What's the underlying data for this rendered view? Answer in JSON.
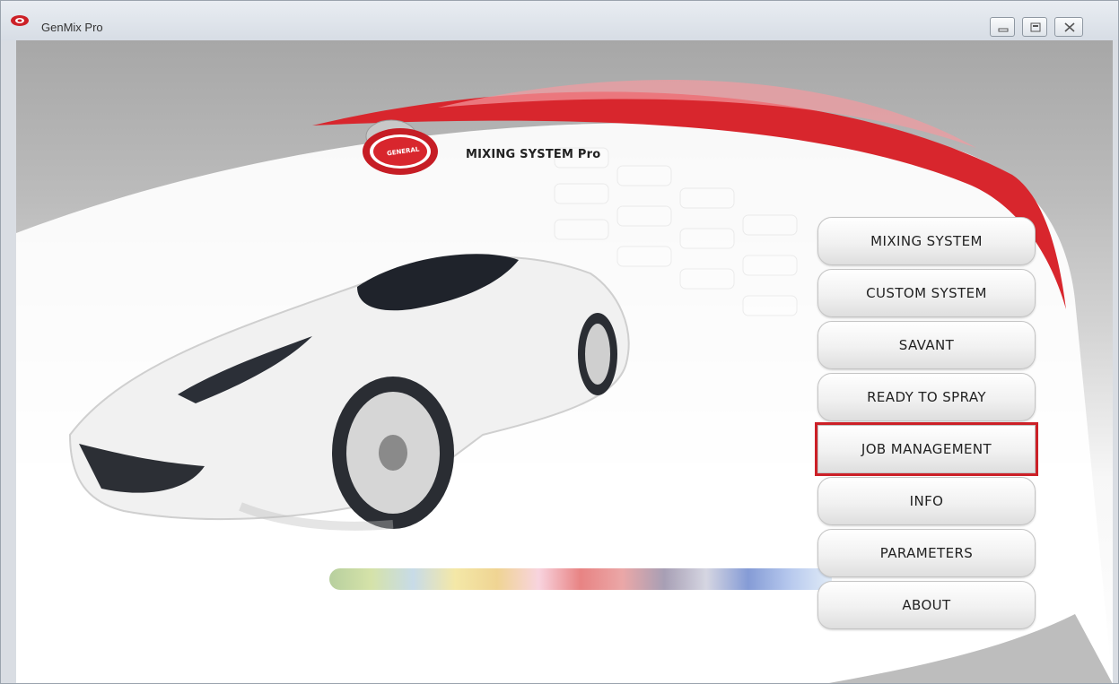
{
  "window": {
    "title": "GenMix Pro",
    "controls": {
      "minimize_icon": "minimize-icon",
      "maximize_icon": "maximize-icon",
      "close_icon": "close-icon"
    }
  },
  "logo": {
    "badge": "GENERAL",
    "text": "MIXING SYSTEM Pro"
  },
  "menu": {
    "items": [
      {
        "label": "MIXING SYSTEM"
      },
      {
        "label": "CUSTOM SYSTEM"
      },
      {
        "label": "SAVANT"
      },
      {
        "label": "READY TO SPRAY"
      },
      {
        "label": "JOB MANAGEMENT"
      },
      {
        "label": "INFO"
      },
      {
        "label": "PARAMETERS"
      },
      {
        "label": "ABOUT"
      }
    ],
    "highlighted": "JOB MANAGEMENT"
  },
  "colors": {
    "accent_red": "#cc2027",
    "highlight_border": "#cc2027"
  }
}
